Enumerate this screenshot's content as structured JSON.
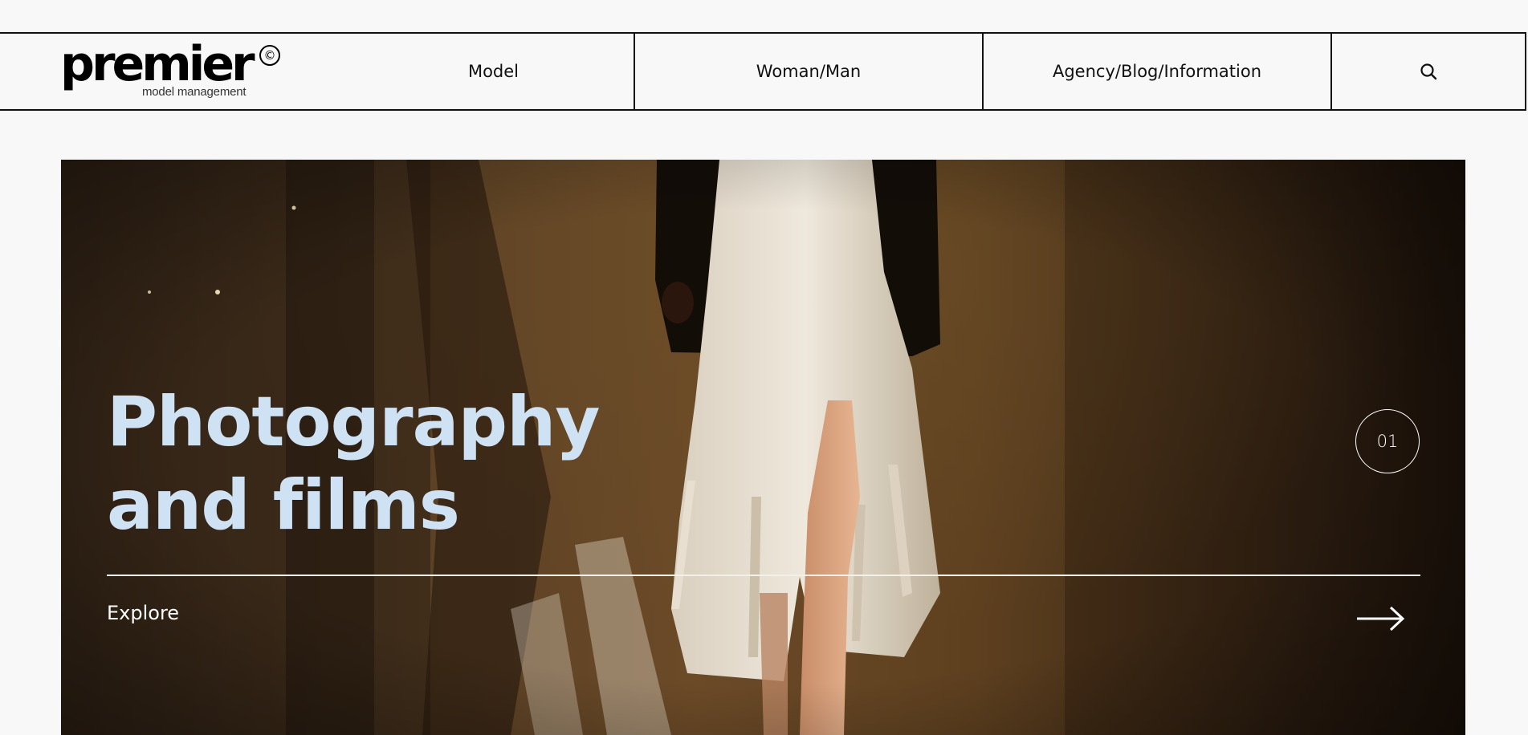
{
  "header": {
    "logo": {
      "wordmark": "premier",
      "copyright_mark": "©",
      "tagline": "model management"
    },
    "nav": [
      {
        "label": "Model"
      },
      {
        "label": "Woman/Man"
      },
      {
        "label": "Agency/Blog/Information"
      }
    ],
    "search_icon": "search-icon"
  },
  "hero": {
    "title_line1": "Photography",
    "title_line2": "and films",
    "slide_counter": "01",
    "cta_label": "Explore",
    "cta_icon": "arrow-right-icon",
    "title_color": "#cfe2f4"
  }
}
